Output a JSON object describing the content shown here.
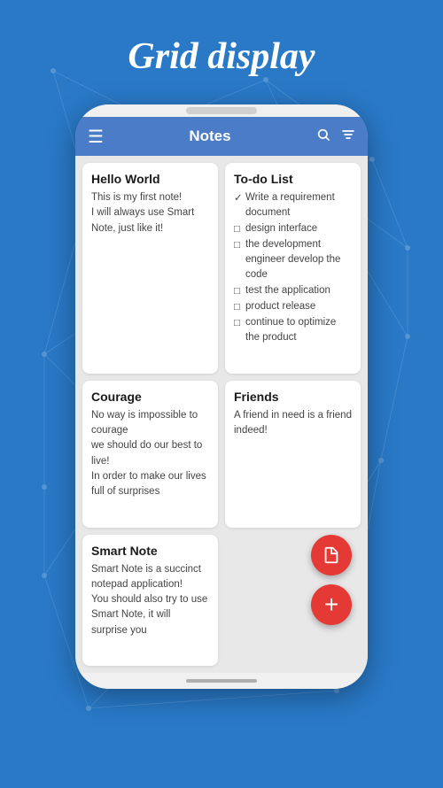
{
  "page": {
    "title": "Grid display",
    "background_color": "#2979c7"
  },
  "app_bar": {
    "title": "Notes",
    "menu_icon": "☰",
    "search_icon": "🔍",
    "filter_icon": "≡"
  },
  "notes": [
    {
      "id": "hello-world",
      "title": "Hello World",
      "body": "This is my first note!\nI will always use Smart Note, just like it!",
      "type": "text"
    },
    {
      "id": "todo-list",
      "title": "To-do List",
      "type": "todo",
      "items": [
        {
          "checked": true,
          "text": "Write a requirement document"
        },
        {
          "checked": false,
          "text": "design interface"
        },
        {
          "checked": false,
          "text": "the development engineer develop the code"
        },
        {
          "checked": false,
          "text": "test the application"
        },
        {
          "checked": false,
          "text": "product release"
        },
        {
          "checked": false,
          "text": "continue to optimize the product"
        }
      ]
    },
    {
      "id": "courage",
      "title": "Courage",
      "body": "No way is impossible to courage\nwe should do our best to live!\nIn order to make our lives full of surprises",
      "type": "text"
    },
    {
      "id": "friends",
      "title": "Friends",
      "body": "A friend in need is a friend indeed!",
      "type": "text"
    },
    {
      "id": "smart-note",
      "title": "Smart Note",
      "body": "Smart Note is a succinct notepad application!\nYou should also try to use Smart Note, it will surprise you",
      "type": "text"
    }
  ],
  "fab": {
    "doc_icon": "📄",
    "add_icon": "+"
  }
}
